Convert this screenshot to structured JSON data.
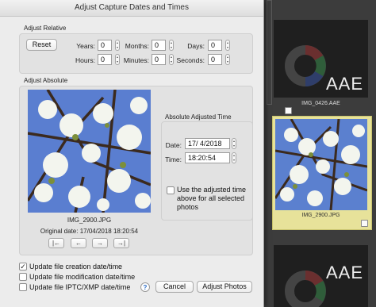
{
  "dialog": {
    "title": "Adjust Capture Dates and Times",
    "relative": {
      "group_label": "Adjust Relative",
      "reset_label": "Reset",
      "years_label": "Years:",
      "years": "0",
      "months_label": "Months:",
      "months": "0",
      "days_label": "Days:",
      "days": "0",
      "hours_label": "Hours:",
      "hours": "0",
      "minutes_label": "Minutes:",
      "minutes": "0",
      "seconds_label": "Seconds:",
      "seconds": "0"
    },
    "absolute": {
      "group_label": "Adjust Absolute",
      "filename": "IMG_2900.JPG",
      "original_date": "Original date: 17/04/2018 18:20:54",
      "nav": [
        "|←",
        "←",
        "→",
        "→|"
      ],
      "panel_title": "Absolute Adjusted Time",
      "date_label": "Date:",
      "date_value": "17/ 4/2018",
      "time_label": "Time:",
      "time_value": "18:20:54",
      "use_adjusted_label_1": "Use the adjusted time",
      "use_adjusted_label_2": "above for all selected",
      "use_adjusted_label_3": "photos",
      "use_adjusted_checked": false
    },
    "options": [
      {
        "label": "Update file creation date/time",
        "checked": true
      },
      {
        "label": "Update file modification date/time",
        "checked": false
      },
      {
        "label": "Update file IPTC/XMP date/time",
        "checked": false
      }
    ],
    "help_label": "?",
    "cancel_label": "Cancel",
    "adjust_label": "Adjust Photos"
  },
  "browser": {
    "thumb_top_label": "IMG_0426.AAE",
    "thumb_selected_label": "IMG_2900.JPG",
    "aae_text": "AAE",
    "selection_color": "#e7e29a"
  }
}
